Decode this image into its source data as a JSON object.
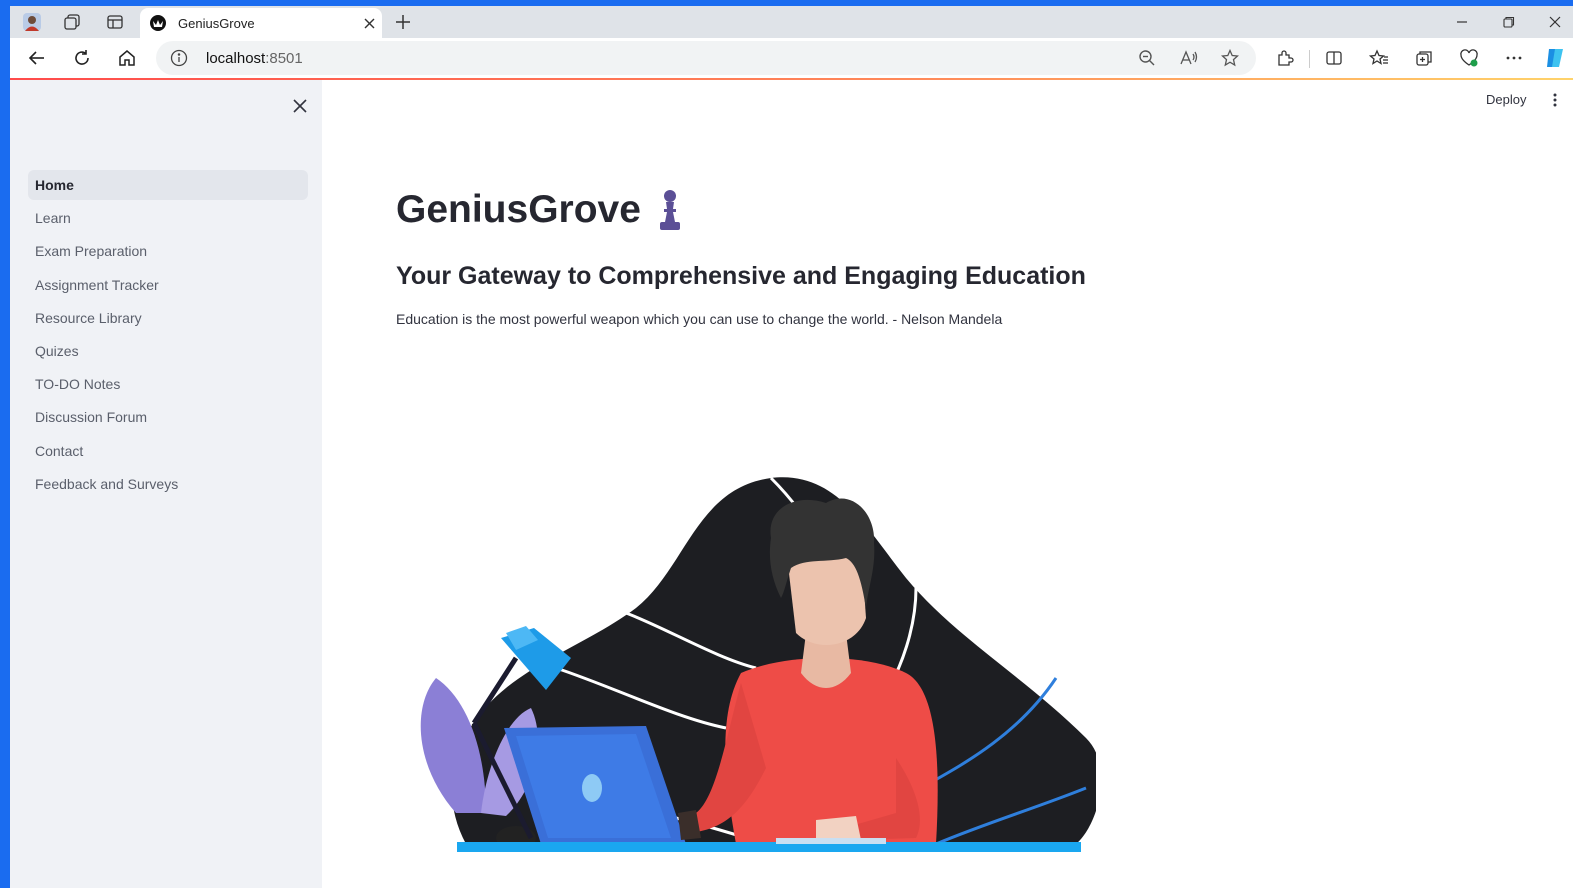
{
  "browser": {
    "tab_title": "GeniusGrove",
    "url_host": "localhost",
    "url_port": ":8501"
  },
  "sidebar": {
    "items": [
      {
        "label": "Home",
        "active": true
      },
      {
        "label": "Learn"
      },
      {
        "label": "Exam Preparation"
      },
      {
        "label": "Assignment Tracker"
      },
      {
        "label": "Resource Library"
      },
      {
        "label": "Quizes"
      },
      {
        "label": "TO-DO Notes"
      },
      {
        "label": "Discussion Forum"
      },
      {
        "label": "Contact"
      },
      {
        "label": "Feedback and Surveys"
      }
    ]
  },
  "header": {
    "deploy_label": "Deploy"
  },
  "main": {
    "title": "GeniusGrove",
    "title_icon": "chess-pawn-icon",
    "subtitle": "Your Gateway to Comprehensive and Engaging Education",
    "quote": "Education is the most powerful weapon which you can use to change the world. - Nelson Mandela",
    "illustration": "person-at-laptop-illustration"
  },
  "colors": {
    "accent": "#ff4b4b",
    "sidebar_bg": "#f0f2f6",
    "text": "#262730",
    "pawn": "#5b4f96",
    "desktop": "#1a6cf0"
  }
}
